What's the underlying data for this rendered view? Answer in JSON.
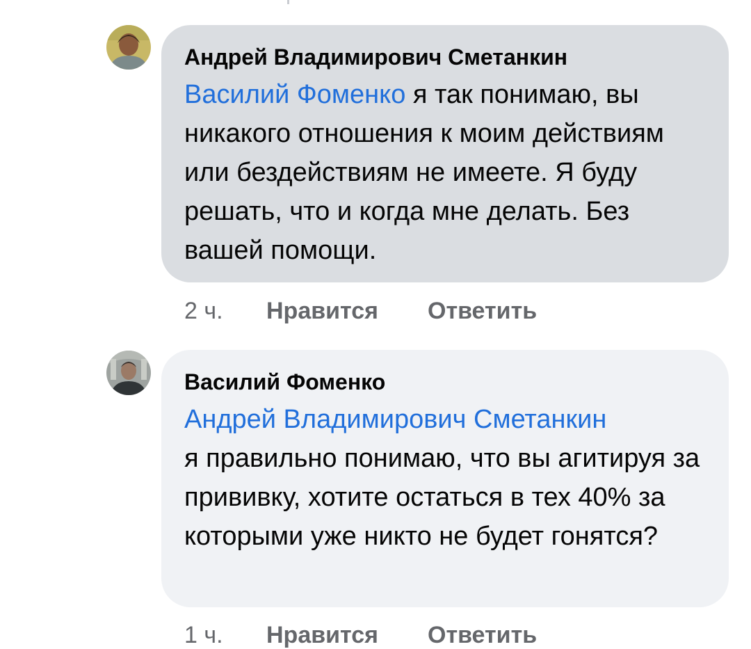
{
  "comments": [
    {
      "author": "Андрей Владимирович Сметанкин",
      "mention": "Василий Фоменко",
      "text": " я так понимаю, вы никакого отношения к моим действиям или бездействиям не имеете. Я буду решать, что и когда мне делать. Без вашей помощи.",
      "time": "2 ч.",
      "like_label": "Нравится",
      "reply_label": "Ответить"
    },
    {
      "author": "Василий Фоменко",
      "mention": "Андрей Владимирович Сметанкин",
      "text": "я правильно понимаю, что вы агитируя за прививку, хотите остаться в тех 40% за которыми уже никто не будет гонятся?",
      "time": "1 ч.",
      "like_label": "Нравится",
      "reply_label": "Ответить"
    }
  ],
  "colors": {
    "mention": "#216fdb",
    "bubble_active": "#dadde1",
    "bubble": "#f0f2f5",
    "meta": "#65676b"
  }
}
